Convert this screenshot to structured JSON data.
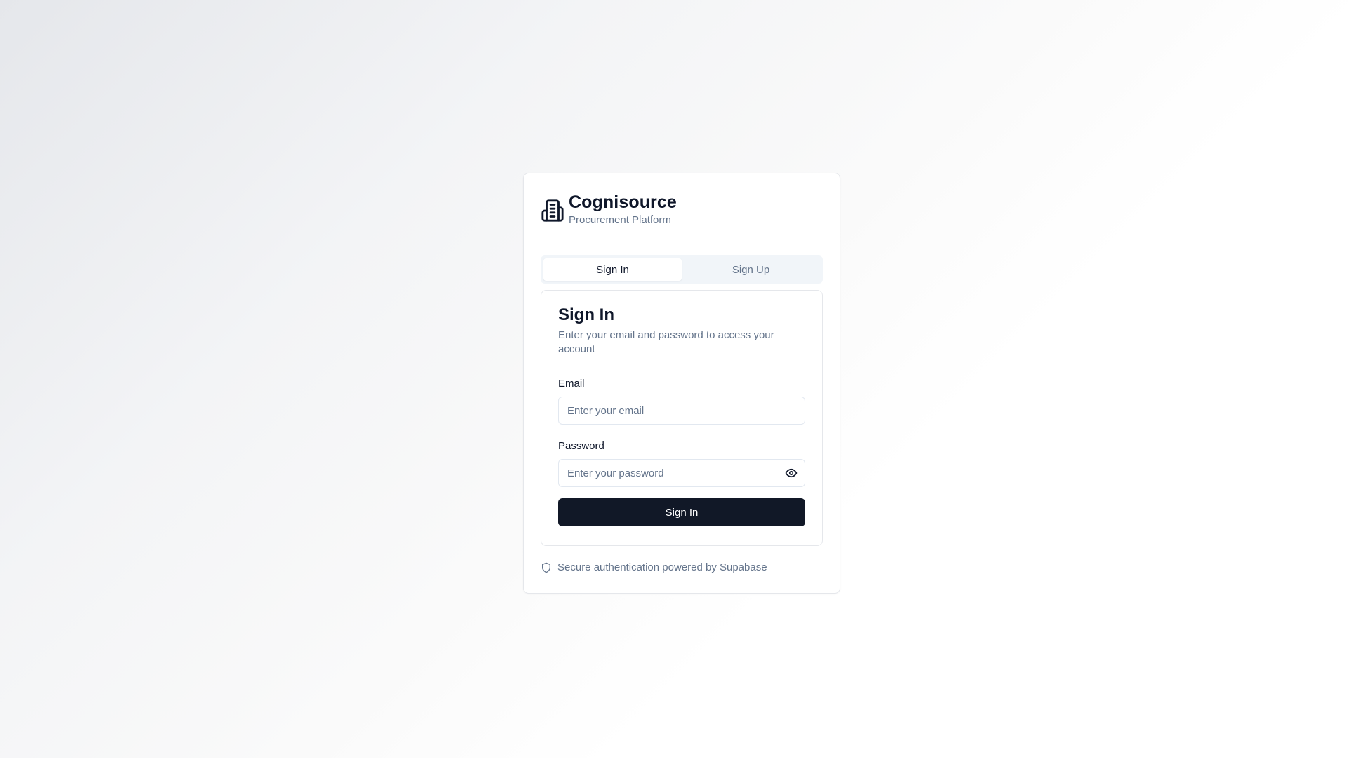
{
  "brand": {
    "title": "Cognisource",
    "subtitle": "Procurement Platform",
    "icon": "building-icon"
  },
  "tabs": [
    {
      "label": "Sign In",
      "active": true
    },
    {
      "label": "Sign Up",
      "active": false
    }
  ],
  "form": {
    "title": "Sign In",
    "description": "Enter your email and password to access your account",
    "email": {
      "label": "Email",
      "value": "",
      "placeholder": "Enter your email"
    },
    "password": {
      "label": "Password",
      "value": "",
      "placeholder": "Enter your password",
      "toggle_icon": "eye-icon"
    },
    "submit_label": "Sign In"
  },
  "footer": {
    "text": "Secure authentication powered by Supabase",
    "icon": "shield-icon"
  },
  "colors": {
    "primary_button": "#111827",
    "muted_text": "#64748b",
    "border": "#e5e7eb"
  }
}
